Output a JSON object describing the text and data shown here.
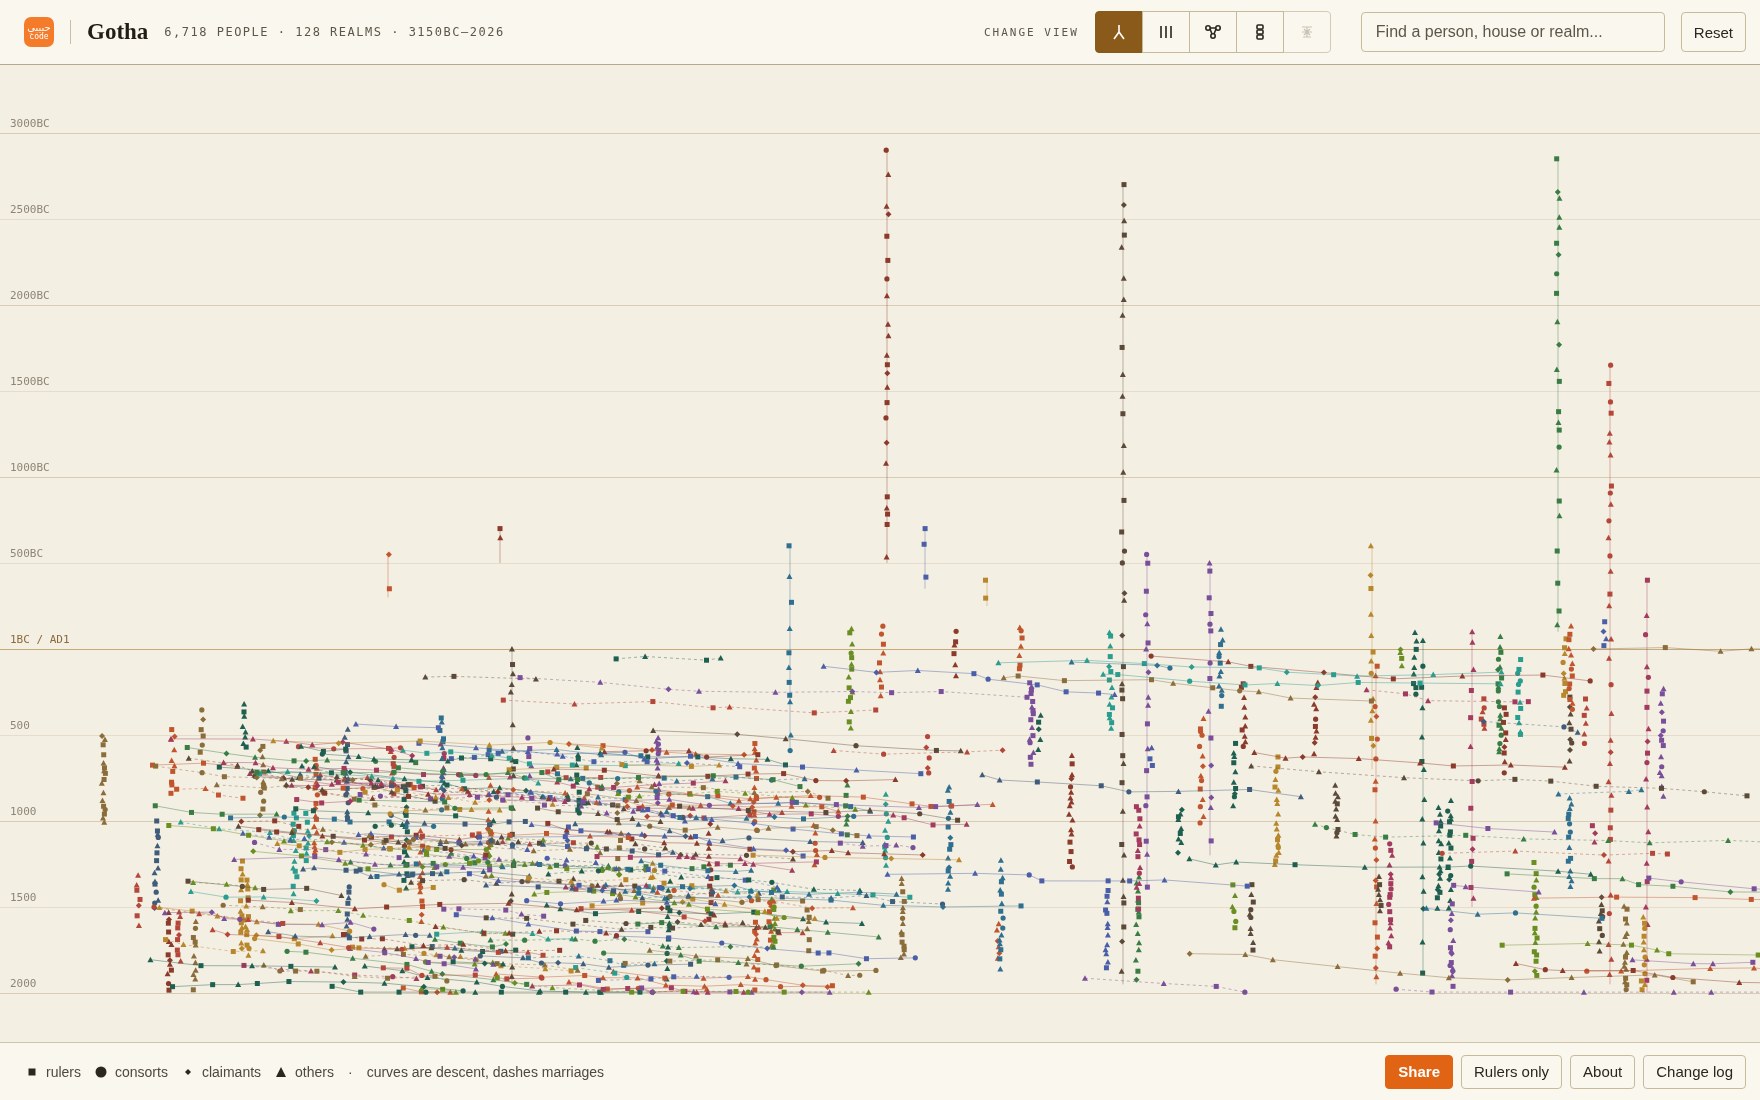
{
  "header": {
    "logo": {
      "top": "حبيبي",
      "bottom": "code"
    },
    "title": "Gotha",
    "stats": "6,718 PEOPLE · 128 REALMS · 3150BC–2026",
    "view_label": "CHANGE VIEW",
    "views": [
      {
        "kind": "fork",
        "selected": true,
        "disabled": false
      },
      {
        "kind": "columns",
        "selected": false,
        "disabled": false
      },
      {
        "kind": "nodes",
        "selected": false,
        "disabled": false
      },
      {
        "kind": "chain",
        "selected": false,
        "disabled": false
      },
      {
        "kind": "glyph",
        "selected": false,
        "disabled": true
      }
    ],
    "search": {
      "placeholder": "Find a person, house or realm..."
    },
    "reset": "Reset"
  },
  "timeline": {
    "ticks": [
      {
        "label": "3000BC",
        "kind": "major"
      },
      {
        "label": "2500BC",
        "kind": "minor"
      },
      {
        "label": "2000BC",
        "kind": "major"
      },
      {
        "label": "1500BC",
        "kind": "minor"
      },
      {
        "label": "1000BC",
        "kind": "major"
      },
      {
        "label": "500BC",
        "kind": "minor"
      },
      {
        "label": "1BC / AD1",
        "kind": "era"
      },
      {
        "label": "500",
        "kind": "minor"
      },
      {
        "label": "1000",
        "kind": "major"
      },
      {
        "label": "1500",
        "kind": "minor"
      },
      {
        "label": "2000",
        "kind": "major"
      }
    ]
  },
  "footer": {
    "legend": [
      {
        "kind": "square",
        "label": "rulers"
      },
      {
        "kind": "circle",
        "label": "consorts"
      },
      {
        "kind": "diamond",
        "label": "claimants"
      },
      {
        "kind": "triangle",
        "label": "others"
      }
    ],
    "separator": "·",
    "note": "curves are descent, dashes marriages",
    "buttons": [
      {
        "label": "Share",
        "kind": "primary"
      },
      {
        "label": "Rulers only",
        "kind": "plain"
      },
      {
        "label": "About",
        "kind": "plain"
      },
      {
        "label": "Change log",
        "kind": "plain"
      }
    ]
  }
}
